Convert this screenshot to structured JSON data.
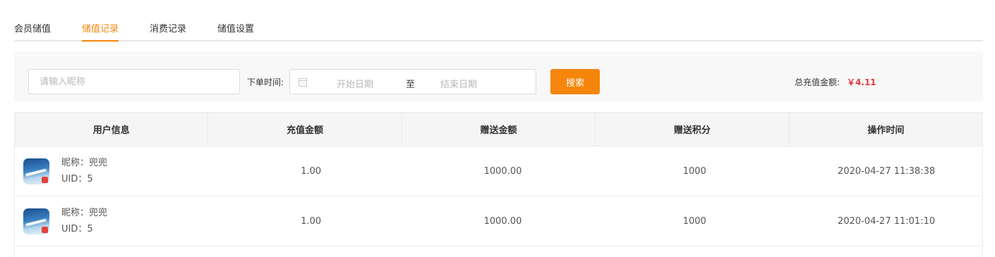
{
  "tabs": [
    {
      "label": "会员储值",
      "active": false
    },
    {
      "label": "储值记录",
      "active": true
    },
    {
      "label": "消费记录",
      "active": false
    },
    {
      "label": "储值设置",
      "active": false
    }
  ],
  "filter": {
    "nickname_placeholder": "请输入昵称",
    "time_label": "下单时间:",
    "date_start_placeholder": "开始日期",
    "date_separator": "至",
    "date_end_placeholder": "结束日期",
    "search_label": "搜索",
    "total_label": "总充值金额:",
    "total_value": "￥4.11"
  },
  "table": {
    "columns": [
      "用户信息",
      "充值金额",
      "赠送金额",
      "赠送积分",
      "操作时间"
    ],
    "rows": [
      {
        "nickname": "昵称：兜兜",
        "uid": "UID：5",
        "amount": "1.00",
        "gift_amount": "1000.00",
        "gift_points": "1000",
        "time": "2020-04-27 11:38:38"
      },
      {
        "nickname": "昵称：兜兜",
        "uid": "UID：5",
        "amount": "1.00",
        "gift_amount": "1000.00",
        "gift_points": "1000",
        "time": "2020-04-27 11:01:10"
      }
    ]
  },
  "colors": {
    "accent": "#f5860b",
    "total_value": "#e4393c"
  }
}
